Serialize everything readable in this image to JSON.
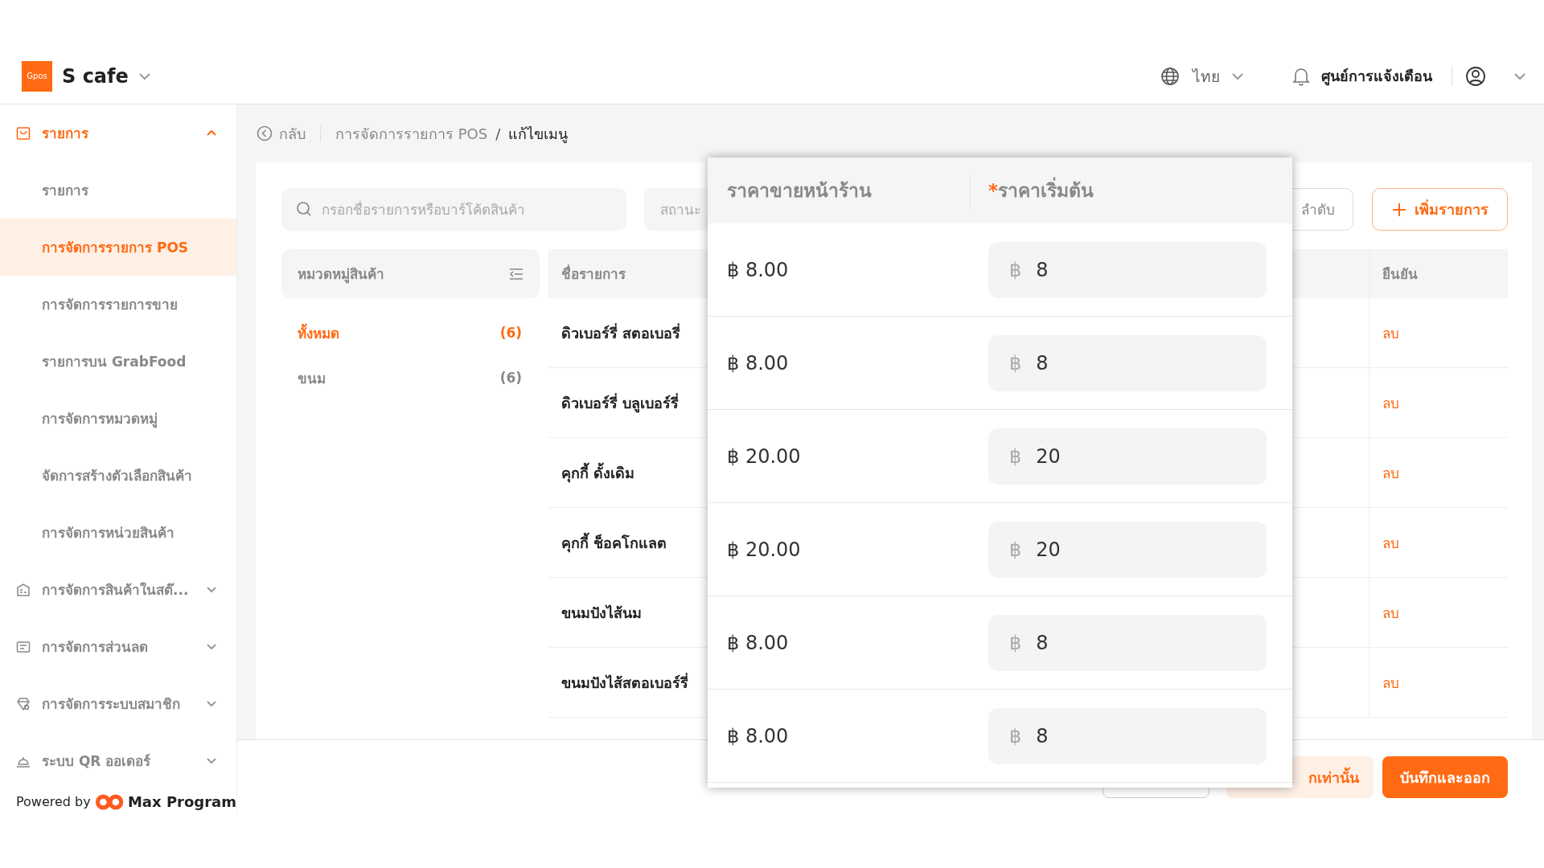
{
  "header": {
    "logo_text": "Gpos",
    "store": "S cafe",
    "language": "ไทย",
    "notifications": "ศูนย์การแจ้งเตือน"
  },
  "sidebar": {
    "groups": [
      {
        "label": "รายการ",
        "expanded": true,
        "children": [
          {
            "label": "รายการ",
            "selected": false
          },
          {
            "label": "การจัดการรายการ POS",
            "selected": true
          },
          {
            "label": "การจัดการรายการขาย",
            "selected": false
          },
          {
            "label": "รายการบน GrabFood",
            "selected": false
          },
          {
            "label": "การจัดการหมวดหมู่",
            "selected": false
          },
          {
            "label": "จัดการสร้างตัวเลือกสินค้า",
            "selected": false
          },
          {
            "label": "การจัดการหน่วยสินค้า",
            "selected": false
          }
        ]
      },
      {
        "label": "การจัดการสินค้าในสต๊...",
        "expanded": false
      },
      {
        "label": "การจัดการส่วนลด",
        "expanded": false
      },
      {
        "label": "การจัดการระบบสมาชิก",
        "expanded": false
      },
      {
        "label": "ระบบ QR ออเดอร์",
        "expanded": false
      }
    ],
    "powered_by": "Powered by",
    "brand": "Max Program"
  },
  "breadcrumb": {
    "back": "กลับ",
    "separator": "/",
    "items": [
      "การจัดการรายการ POS",
      "แก้ไขเมนู"
    ]
  },
  "toolbar": {
    "search_placeholder": "กรอกชื่อรายการหรือบาร์โค้ดสินค้า",
    "status_placeholder": "สถานะ",
    "sort_button": "ลำดับ",
    "add_button": "เพิ่มรายการ"
  },
  "categories": {
    "title": "หมวดหมู่สินค้า",
    "items": [
      {
        "label": "ทั้งหมด",
        "count": "(6)",
        "selected": true
      },
      {
        "label": "ขนม",
        "count": "(6)",
        "selected": false
      }
    ]
  },
  "table": {
    "columns": [
      "ชื่อรายการ",
      "ยืนยัน"
    ],
    "rows": [
      {
        "name": "ดิวเบอร์รี่ สตอเบอรี่",
        "action": "ลบ"
      },
      {
        "name": "ดิวเบอร์รี่ บลูเบอร์รี่",
        "action": "ลบ"
      },
      {
        "name": "คุกกี้ ดั้งเดิม",
        "action": "ลบ"
      },
      {
        "name": "คุกกี้ ช็อคโกแลต",
        "action": "ลบ"
      },
      {
        "name": "ขนมปังไส้นม",
        "action": "ลบ"
      },
      {
        "name": "ขนมปังไส้สตอเบอร์รี่",
        "action": "ลบ"
      }
    ]
  },
  "price_popup": {
    "columns": [
      {
        "label": "ราคาขายหน้าร้าน"
      },
      {
        "label": "ราคาเริ่มต้น",
        "required_mark": "*"
      }
    ],
    "rows": [
      {
        "store_price": "฿ 8.00",
        "currency": "฿",
        "start_price": "8"
      },
      {
        "store_price": "฿ 8.00",
        "currency": "฿",
        "start_price": "8"
      },
      {
        "store_price": "฿ 20.00",
        "currency": "฿",
        "start_price": "20"
      },
      {
        "store_price": "฿ 20.00",
        "currency": "฿",
        "start_price": "20"
      },
      {
        "store_price": "฿ 8.00",
        "currency": "฿",
        "start_price": "8"
      },
      {
        "store_price": "฿ 8.00",
        "currency": "฿",
        "start_price": "8"
      }
    ]
  },
  "footer": {
    "buttons": [
      {
        "kind": "outline"
      },
      {
        "kind": "light",
        "label": "กเท่านั้น"
      },
      {
        "kind": "primary",
        "label": "บันทึกและออก"
      }
    ]
  }
}
